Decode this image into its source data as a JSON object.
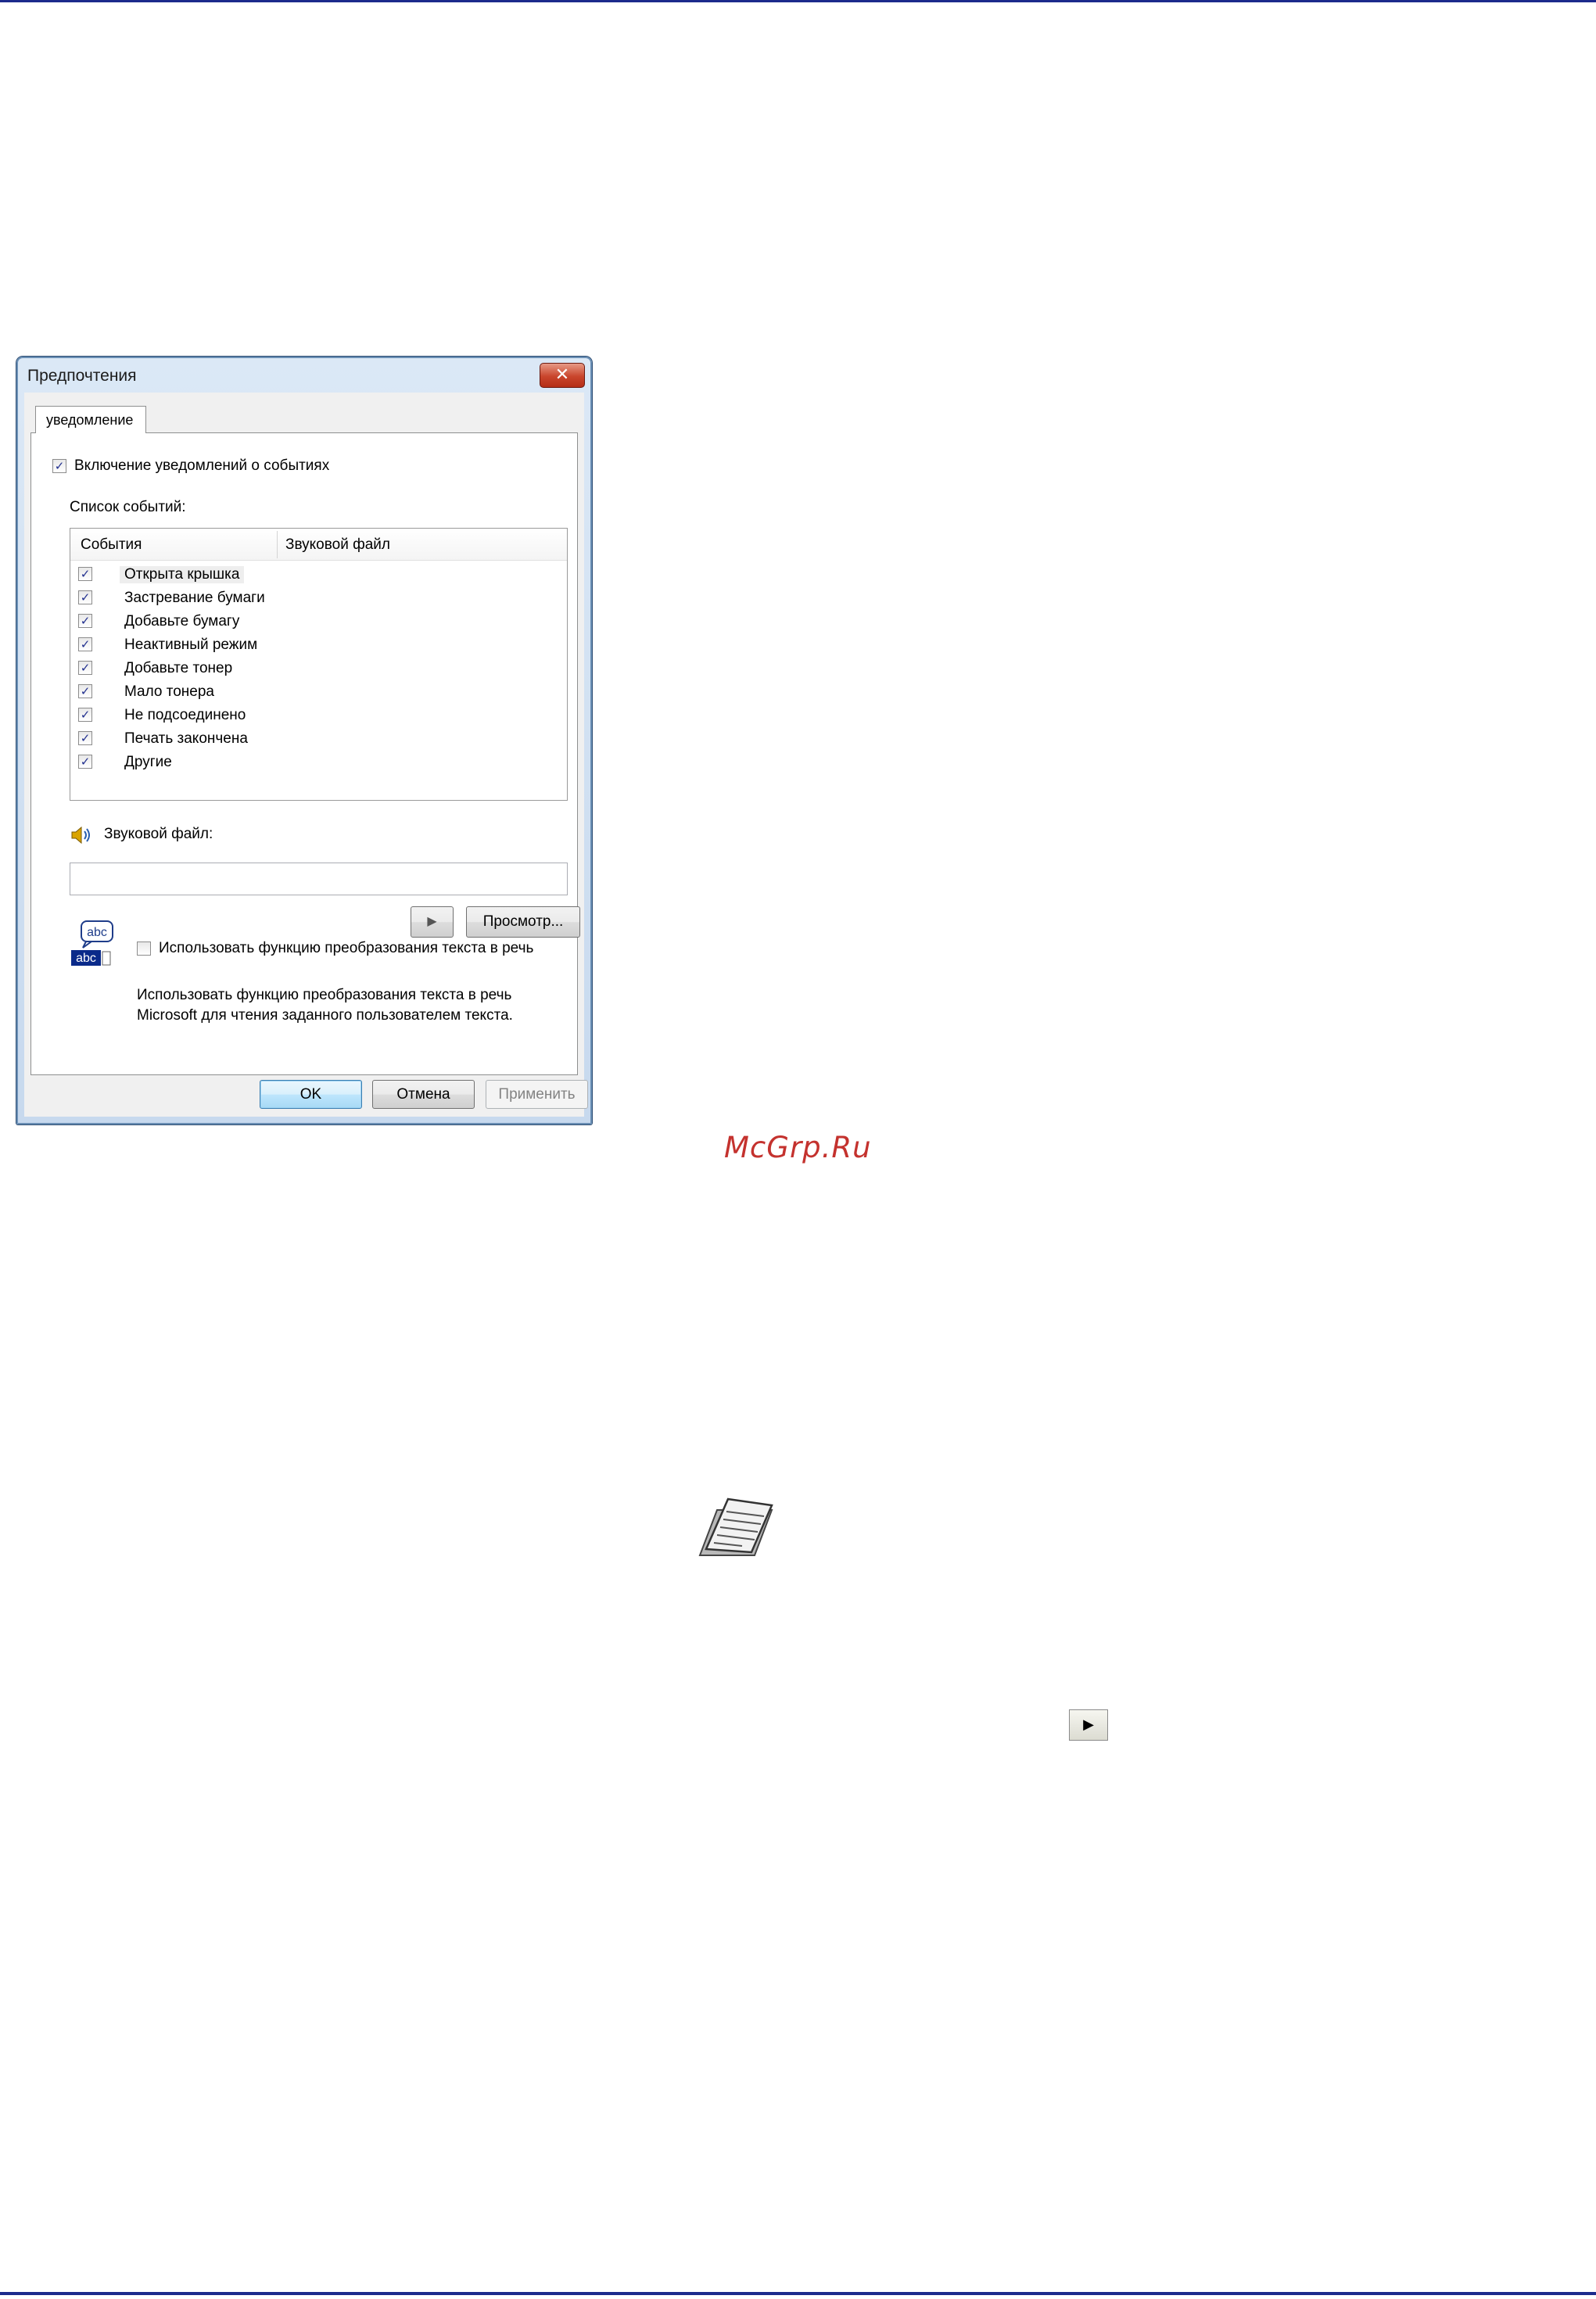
{
  "dialog": {
    "title": "Предпочтения",
    "close_label": "✕",
    "tab_label": "уведомление",
    "enable_notifications": {
      "label": "Включение уведомлений о событиях",
      "checked": true
    },
    "event_list_label": "Список событий:",
    "columns": [
      "События",
      "Звуковой файл"
    ],
    "events": [
      {
        "label": "Открыта крышка",
        "checked": true,
        "selected": true
      },
      {
        "label": "Застревание бумаги",
        "checked": true
      },
      {
        "label": "Добавьте бумагу",
        "checked": true
      },
      {
        "label": "Неактивный режим",
        "checked": true
      },
      {
        "label": "Добавьте тонер",
        "checked": true
      },
      {
        "label": "Мало тонера",
        "checked": true
      },
      {
        "label": "Не подсоединено",
        "checked": true
      },
      {
        "label": "Печать закончена",
        "checked": true
      },
      {
        "label": "Другие",
        "checked": true
      }
    ],
    "sound_file_label": "Звуковой файл:",
    "sound_file_value": "",
    "play_label": "▶",
    "browse_label": "Просмотр...",
    "tts_icon_top": "abc",
    "tts_icon_bottom": "abc",
    "tts_checkbox": {
      "label": "Использовать функцию преобразования текста в речь",
      "checked": false
    },
    "tts_description_line1": "Использовать функцию преобразования текста в речь",
    "tts_description_line2": "Microsoft для чтения заданного пользователем текста.",
    "ok_label": "OK",
    "cancel_label": "Отмена",
    "apply_label": "Применить"
  },
  "watermark": "McGrp.Ru",
  "inline_play_label": "▶",
  "colors": {
    "rule": "#1c2a8c",
    "watermark": "#c4322e",
    "checkmark": "#22308f"
  }
}
